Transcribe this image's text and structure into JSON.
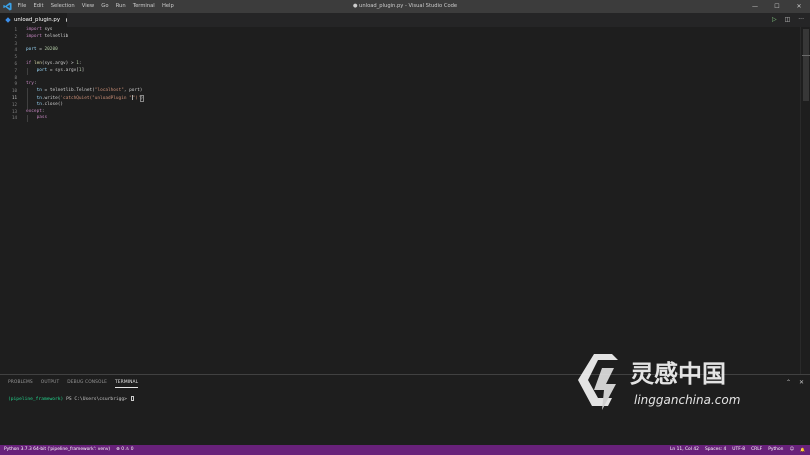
{
  "window": {
    "title": "● unload_plugin.py - Visual Studio Code",
    "controls": {
      "minimize": "—",
      "maximize": "☐",
      "close": "✕"
    }
  },
  "menu": [
    "File",
    "Edit",
    "Selection",
    "View",
    "Go",
    "Run",
    "Terminal",
    "Help"
  ],
  "tab": {
    "label": "unload_plugin.py",
    "icon": "python-file-icon",
    "dirty": true
  },
  "editor_actions": {
    "run": "▷",
    "split": "◫",
    "more": "···"
  },
  "editor": {
    "line_numbers": [
      "1",
      "2",
      "3",
      "4",
      "5",
      "6",
      "7",
      "8",
      "9",
      "10",
      "11",
      "12",
      "13",
      "14"
    ],
    "lines": [
      {
        "import_kw": "import",
        "module": " sys"
      },
      {
        "import_kw": "import",
        "module": " telnetlib"
      },
      {},
      {
        "var": "port",
        "op": " = ",
        "num": "20200"
      },
      {},
      {
        "kw": "if",
        "fn": " len",
        "rest": "(sys.argv) > ",
        "num": "1",
        "end": ":"
      },
      {
        "var": "port",
        "op": " = ",
        "rest": "sys.argv[",
        "num": "1",
        "end": "]"
      },
      {},
      {
        "kw": "try",
        "end": ":"
      },
      {
        "var": "tn",
        "op": " = ",
        "rest": "telnetlib.Telnet(",
        "str": "\"localhost\"",
        "end": ", port)"
      },
      {
        "var": "tn",
        "rest": ".write(",
        "str1": "'catchQuiet(\"unloadPlugin \"",
        "str2": "\")'",
        "end": ")"
      },
      {
        "var": "tn",
        "rest": ".close()"
      },
      {
        "kw": "except",
        "end": ":"
      },
      {
        "kw": "pass"
      }
    ]
  },
  "panel": {
    "tabs": [
      "PROBLEMS",
      "OUTPUT",
      "DEBUG CONSOLE",
      "TERMINAL"
    ],
    "active_tab": "TERMINAL",
    "terminal": {
      "venv": "(pipeline_framework)",
      "prompt": " PS C:\\Users\\csurbrigg> "
    }
  },
  "watermark": {
    "brand": "灵感中国",
    "url": "lingganchina.com"
  },
  "statusbar": {
    "interpreter": "Python 3.7.3 64-bit ('pipeline_framework': venv)",
    "problems": "⊗ 0 ⚠ 0",
    "position": "Ln 11, Col 42",
    "spaces": "Spaces: 4",
    "encoding": "UTF-8",
    "eol": "CRLF",
    "language": "Python",
    "feedback": "☺",
    "bell": "🔔"
  },
  "colors": {
    "statusbar_bg": "#68217a",
    "titlebar_bg": "#3c3c3c",
    "editor_bg": "#1e1e1e",
    "keyword": "#c586c0",
    "string": "#ce9178",
    "number": "#b5cea8",
    "function": "#dcdcaa",
    "variable": "#9cdcfe",
    "terminal_green": "#23d18b"
  }
}
